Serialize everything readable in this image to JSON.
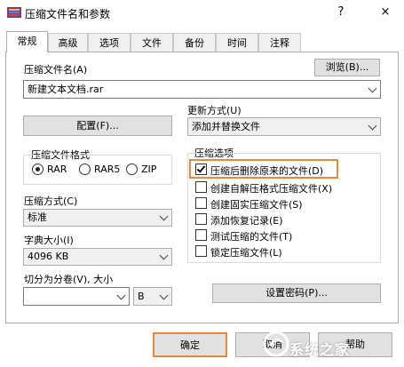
{
  "window": {
    "title": "压缩文件名和参数",
    "help": "?",
    "close": "×"
  },
  "tabs": [
    {
      "label": "常规"
    },
    {
      "label": "高级"
    },
    {
      "label": "选项"
    },
    {
      "label": "文件"
    },
    {
      "label": "备份"
    },
    {
      "label": "时间"
    },
    {
      "label": "注释"
    }
  ],
  "general": {
    "archive_name_label": "压缩文件名(A)",
    "browse_label": "浏览(B)...",
    "archive_name_value": "新建文本文档.rar",
    "profiles_label": "配置(F)...",
    "update_mode_label": "更新方式(U)",
    "update_mode_value": "添加并替换文件",
    "format_group_label": "压缩文件格式",
    "formats": [
      "RAR",
      "RAR5",
      "ZIP"
    ],
    "method_label": "压缩方式(C)",
    "method_value": "标准",
    "dict_label": "字典大小(I)",
    "dict_value": "4096 KB",
    "split_label": "切分为分卷(V), 大小",
    "split_value": "",
    "split_unit": "B",
    "options_group_label": "压缩选项",
    "options": [
      {
        "label": "压缩后删除原来的文件(D)",
        "checked": true
      },
      {
        "label": "创建自解压格式压缩文件(X)",
        "checked": false
      },
      {
        "label": "创建固实压缩文件(S)",
        "checked": false
      },
      {
        "label": "添加恢复记录(E)",
        "checked": false
      },
      {
        "label": "测试压缩的文件(T)",
        "checked": false
      },
      {
        "label": "锁定压缩文件(L)",
        "checked": false
      }
    ],
    "password_label": "设置密码(P)..."
  },
  "footer": {
    "ok_label": "确定",
    "cancel_label": "取消",
    "help_label": "帮助"
  },
  "watermark": "系统之家",
  "colors": {
    "highlight": "#e8883a",
    "button": "#e1e1e1"
  }
}
